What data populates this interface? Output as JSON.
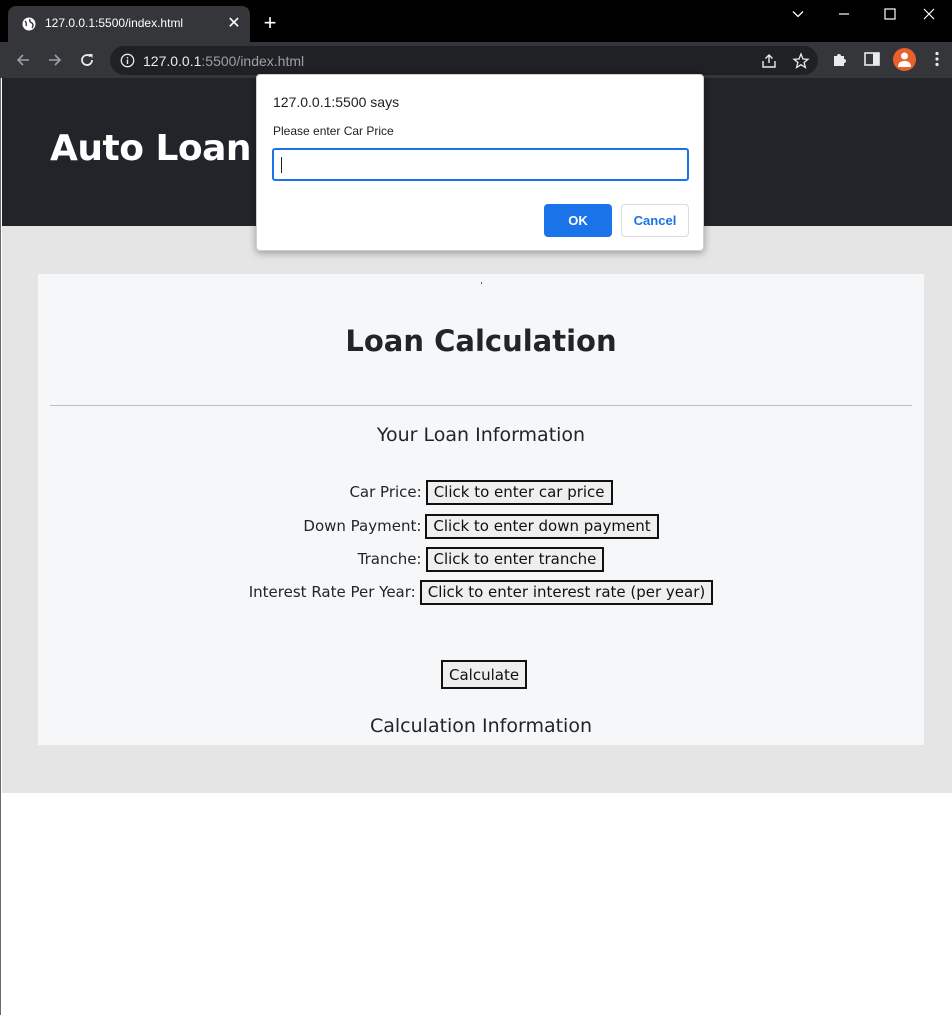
{
  "browser": {
    "tab_title": "127.0.0.1:5500/index.html",
    "url_host": "127.0.0.1",
    "url_rest": ":5500/index.html",
    "tab_close_glyph": "✕",
    "new_tab_glyph": "+",
    "colors": {
      "titlebar": "#000000",
      "toolbar": "#35363a",
      "accent": "#1a73e8",
      "avatar": "#e8612c"
    }
  },
  "page": {
    "header_title": "Auto Loan Ca",
    "card": {
      "title": "Loan Calculation",
      "loan_info_heading": "Your Loan Information",
      "fields": [
        {
          "label": "Car Price:",
          "button": "Click to enter car price"
        },
        {
          "label": "Down Payment:",
          "button": "Click to enter down payment"
        },
        {
          "label": "Tranche:",
          "button": "Click to enter tranche"
        },
        {
          "label": "Interest Rate Per Year:",
          "button": "Click to enter interest rate (per year)"
        }
      ],
      "calculate_label": "Calculate",
      "calc_info_heading": "Calculation Information"
    }
  },
  "dialog": {
    "origin": "127.0.0.1:5500 says",
    "message": "Please enter Car Price",
    "input_value": "",
    "ok_label": "OK",
    "cancel_label": "Cancel"
  }
}
